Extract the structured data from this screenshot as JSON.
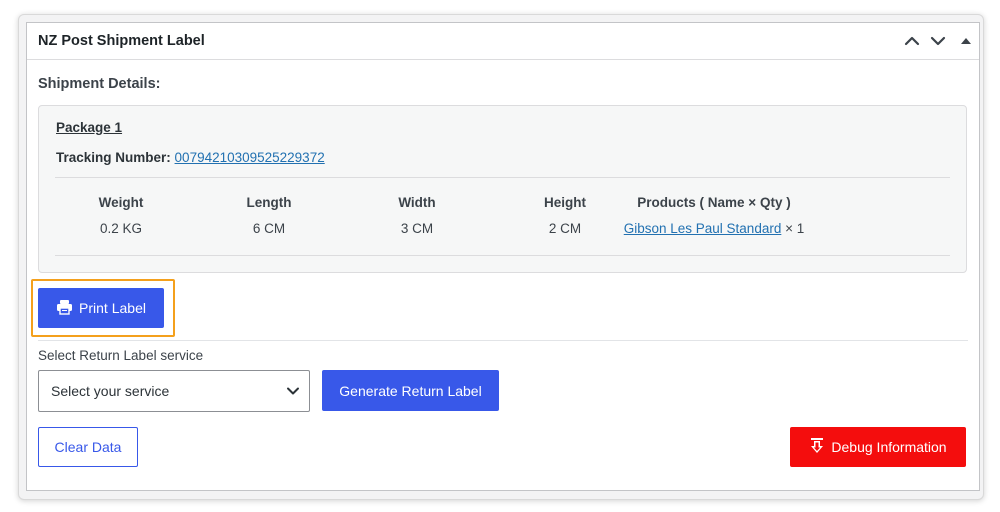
{
  "panel": {
    "title": "NZ Post Shipment Label",
    "controls": [
      "chevron-up-icon",
      "chevron-down-icon",
      "toggle-arrow-icon"
    ]
  },
  "shipment": {
    "title": "Shipment Details:",
    "package": {
      "title": "Package 1",
      "tracking_label": "Tracking Number:",
      "tracking_number": "00794210309525229372",
      "columns": [
        "Weight",
        "Length",
        "Width",
        "Height",
        "Products ( Name × Qty )"
      ],
      "values": {
        "weight": "0.2 KG",
        "length": "6 CM",
        "width": "3 CM",
        "height": "2 CM",
        "product_name": "Gibson Les Paul Standard",
        "product_qty": " × 1"
      }
    }
  },
  "actions": {
    "print_label": "Print Label",
    "return_label_text": "Select Return Label service",
    "select_placeholder": "Select your service",
    "generate_return": "Generate Return Label",
    "clear_data": "Clear Data",
    "debug_info": "Debug Information"
  },
  "colors": {
    "primary": "#3858e9",
    "danger": "#f40d0d",
    "link": "#2271b1",
    "highlight": "#f4a01c"
  }
}
